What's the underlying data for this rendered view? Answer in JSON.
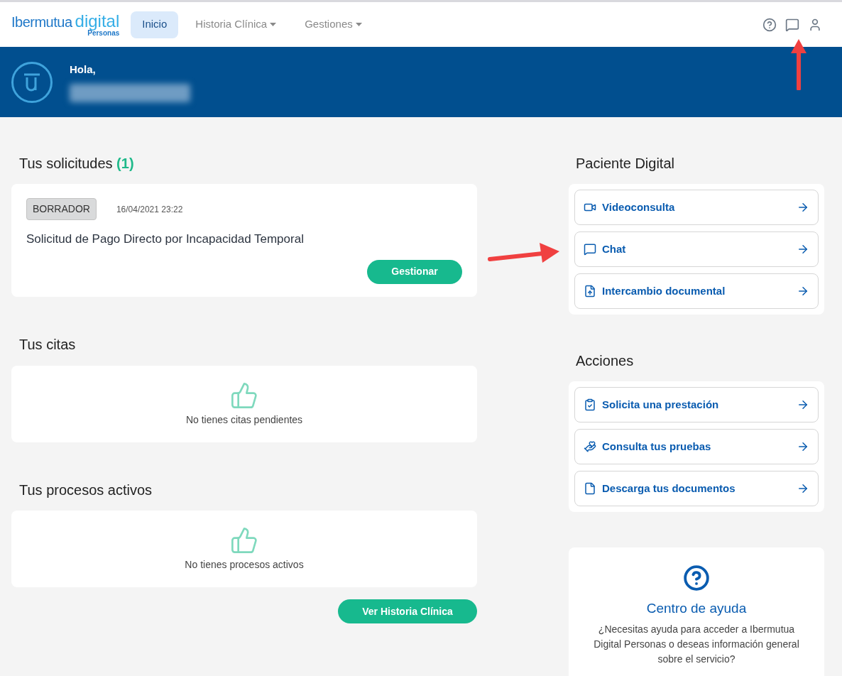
{
  "header": {
    "logo": {
      "brand": "Ibermutua",
      "product": "digital",
      "sub": "Personas"
    },
    "nav": [
      {
        "label": "Inicio",
        "selected": true,
        "dropdown": false
      },
      {
        "label": "Historia Clínica",
        "selected": false,
        "dropdown": true
      },
      {
        "label": "Gestiones",
        "selected": false,
        "dropdown": true
      }
    ],
    "icons": [
      {
        "kind": "help"
      },
      {
        "kind": "chat"
      },
      {
        "kind": "user"
      }
    ]
  },
  "banner": {
    "greeting": "Hola,"
  },
  "requests": {
    "title": "Tus solicitudes",
    "count": "(1)",
    "items": [
      {
        "status": "BORRADOR",
        "date": "16/04/2021 23:22",
        "title": "Solicitud de Pago Directo por Incapacidad Temporal",
        "action": "Gestionar"
      }
    ]
  },
  "appointments": {
    "title": "Tus citas",
    "empty": "No tienes citas pendientes"
  },
  "processes": {
    "title": "Tus procesos activos",
    "empty": "No tienes procesos activos"
  },
  "history_button": "Ver Historia Clínica",
  "digital_patient": {
    "title": "Paciente Digital",
    "items": [
      {
        "kind": "video",
        "label": "Videoconsulta"
      },
      {
        "kind": "chat",
        "label": "Chat"
      },
      {
        "kind": "upload",
        "label": "Intercambio documental"
      }
    ]
  },
  "actions": {
    "title": "Acciones",
    "items": [
      {
        "kind": "clipboard",
        "label": "Solicita una prestación"
      },
      {
        "kind": "hand",
        "label": "Consulta tus pruebas"
      },
      {
        "kind": "file",
        "label": "Descarga tus documentos"
      }
    ]
  },
  "help": {
    "title": "Centro de ayuda",
    "text": "¿Necesitas ayuda para acceder a Ibermutua Digital Personas o deseas información general sobre el servicio?"
  }
}
